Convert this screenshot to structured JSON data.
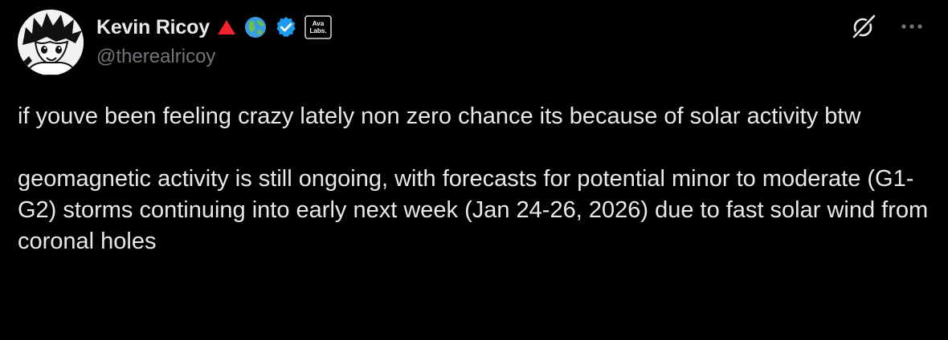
{
  "author": {
    "display_name": "Kevin Ricoy",
    "handle": "@therealricoy",
    "avatar_icon": "anime-character-avatar",
    "badges": [
      {
        "icon": "red-triangle-icon",
        "color": "#f4212e"
      },
      {
        "icon": "globe-icon",
        "color": "#3a9be0"
      },
      {
        "icon": "verified-badge-icon",
        "color": "#1d9bf0"
      },
      {
        "icon": "affiliate-badge-icon",
        "text_line1": "Ava",
        "text_line2": "Labs."
      }
    ]
  },
  "actions": {
    "grok_icon": "grok-icon",
    "more_icon": "more-options-icon"
  },
  "post": {
    "paragraphs": [
      "if youve been feeling crazy lately non zero chance its because of solar activity btw",
      "geomagnetic activity is still ongoing, with forecasts for potential minor to moderate (G1-G2) storms continuing into early next week (Jan 24-26, 2026) due to fast solar wind from coronal holes"
    ]
  },
  "colors": {
    "background": "#000000",
    "text": "#e7e9ea",
    "secondary_text": "#71767b",
    "accent": "#1d9bf0"
  }
}
